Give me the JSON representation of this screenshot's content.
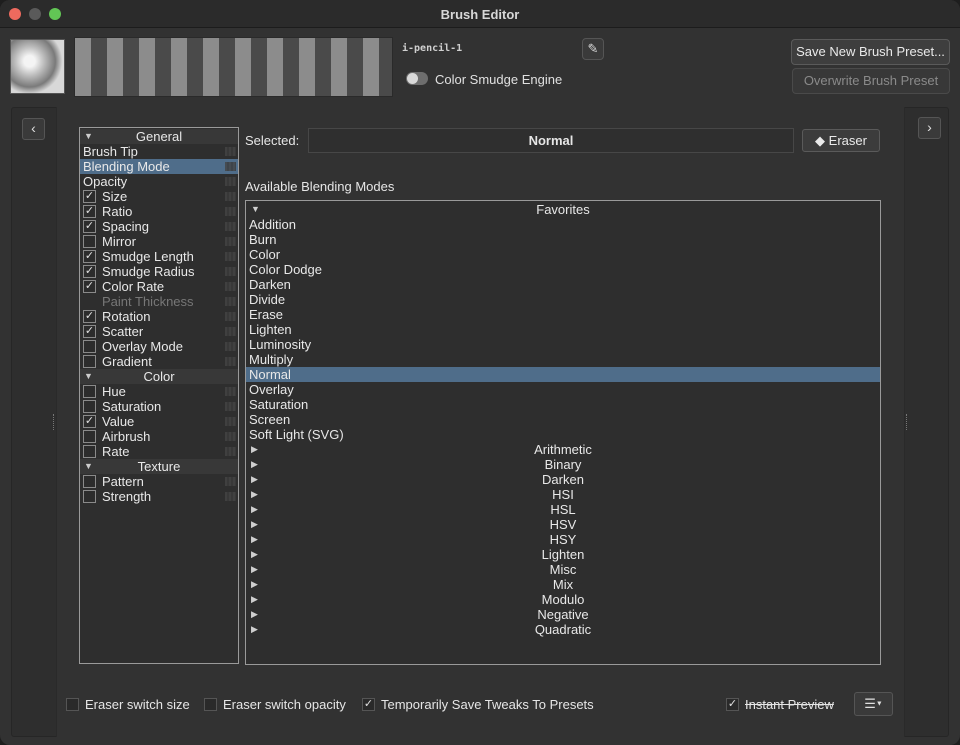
{
  "window": {
    "title": "Brush Editor"
  },
  "header": {
    "preset_name": "i-pencil-1",
    "engine_label": "Color Smudge Engine",
    "save_label": "Save New Brush Preset...",
    "overwrite_label": "Overwrite Brush Preset"
  },
  "options": [
    {
      "type": "header",
      "label": "General"
    },
    {
      "type": "plain",
      "label": "Brush Tip"
    },
    {
      "type": "plain",
      "label": "Blending Mode",
      "selected": true
    },
    {
      "type": "plain",
      "label": "Opacity"
    },
    {
      "type": "check",
      "label": "Size",
      "checked": true
    },
    {
      "type": "check",
      "label": "Ratio",
      "checked": true
    },
    {
      "type": "check",
      "label": "Spacing",
      "checked": true
    },
    {
      "type": "check",
      "label": "Mirror",
      "checked": false
    },
    {
      "type": "check",
      "label": "Smudge Length",
      "checked": true
    },
    {
      "type": "check",
      "label": "Smudge Radius",
      "checked": true
    },
    {
      "type": "check",
      "label": "Color Rate",
      "checked": true
    },
    {
      "type": "check",
      "label": "Paint Thickness",
      "checked": false,
      "disabled": true
    },
    {
      "type": "check",
      "label": "Rotation",
      "checked": true
    },
    {
      "type": "check",
      "label": "Scatter",
      "checked": true
    },
    {
      "type": "check",
      "label": "Overlay Mode",
      "checked": false
    },
    {
      "type": "check",
      "label": "Gradient",
      "checked": false
    },
    {
      "type": "header",
      "label": "Color"
    },
    {
      "type": "check",
      "label": "Hue",
      "checked": false
    },
    {
      "type": "check",
      "label": "Saturation",
      "checked": false
    },
    {
      "type": "check",
      "label": "Value",
      "checked": true
    },
    {
      "type": "check",
      "label": "Airbrush",
      "checked": false
    },
    {
      "type": "check",
      "label": "Rate",
      "checked": false
    },
    {
      "type": "header",
      "label": "Texture"
    },
    {
      "type": "check",
      "label": "Pattern",
      "checked": false
    },
    {
      "type": "check",
      "label": "Strength",
      "checked": false
    }
  ],
  "blending": {
    "selected_label": "Selected:",
    "selected_value": "Normal",
    "eraser_label": "Eraser",
    "available_label": "Available Blending Modes",
    "favorites_label": "Favorites",
    "favorites": [
      "Addition",
      "Burn",
      "Color",
      "Color Dodge",
      "Darken",
      "Divide",
      "Erase",
      "Lighten",
      "Luminosity",
      "Multiply",
      "Normal",
      "Overlay",
      "Saturation",
      "Screen",
      "Soft Light (SVG)"
    ],
    "selected_mode": "Normal",
    "groups": [
      "Arithmetic",
      "Binary",
      "Darken",
      "HSI",
      "HSL",
      "HSV",
      "HSY",
      "Lighten",
      "Misc",
      "Mix",
      "Modulo",
      "Negative",
      "Quadratic"
    ]
  },
  "footer": {
    "eraser_size": "Eraser switch size",
    "eraser_opacity": "Eraser switch opacity",
    "save_tweaks": "Temporarily Save Tweaks To Presets",
    "instant_preview": "Instant Preview",
    "eraser_size_checked": false,
    "eraser_opacity_checked": false,
    "save_tweaks_checked": true,
    "instant_preview_checked": true
  },
  "icons": {
    "edit": "pencil-icon",
    "eraser": "eraser-icon",
    "nav_left": "chevron-left-icon",
    "nav_right": "chevron-right-icon",
    "menu": "hamburger-menu-icon"
  }
}
